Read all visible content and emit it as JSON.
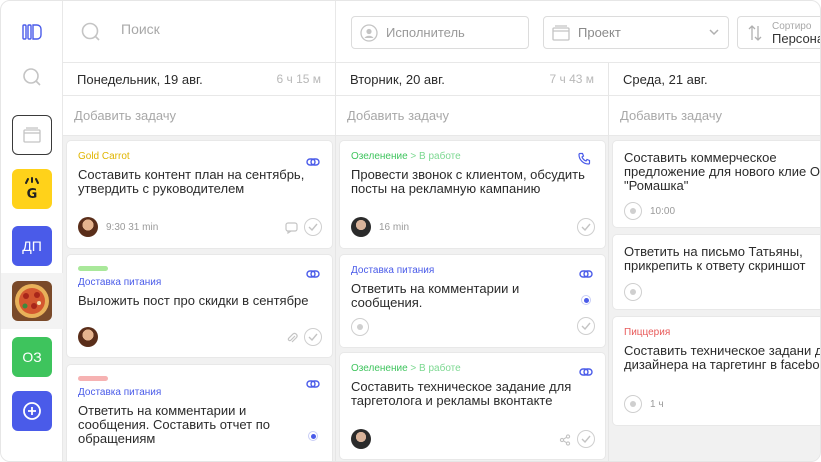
{
  "search": {
    "placeholder": "Поиск"
  },
  "filters": {
    "executor": "Исполнитель",
    "project": "Проект",
    "sort_small": "Сортиро",
    "sort_value": "Персона"
  },
  "sidebar": {
    "items": [
      {
        "label": "ДП"
      },
      {
        "label": "ОЗ"
      }
    ]
  },
  "columns": [
    {
      "day": "Понедельник, 19 авг.",
      "duration": "6 ч 15 м",
      "add_task": "Добавить задачу",
      "cards": [
        {
          "project": "Gold Carrot",
          "project_color": "#e0b500",
          "title": "Составить контент план на сентябрь, утвердить с руководителем",
          "time": "9:30 31 min"
        },
        {
          "project": "Доставка питания",
          "project_color": "#4a5be9",
          "bar_color": "#a9e89a",
          "title": "Выложить пост про скидки в сентябре"
        },
        {
          "project": "Доставка питания",
          "project_color": "#4a5be9",
          "bar_color": "#f6b2b2",
          "title": "Ответить на комментарии и сообщения. Составить отчет по обращениям"
        }
      ]
    },
    {
      "day": "Вторник, 20 авг.",
      "duration": "7 ч 43 м",
      "add_task": "Добавить задачу",
      "cards": [
        {
          "project": "Озеленение",
          "status": "> В работе",
          "project_color": "#3ec45d",
          "title": "Провести звонок с клиентом, обсудить посты на рекламную кампанию",
          "time": "16 min"
        },
        {
          "project": "Доставка питания",
          "project_color": "#4a5be9",
          "title": "Ответить на комментарии и сообщения."
        },
        {
          "project": "Озеленение",
          "status": "> В работе",
          "project_color": "#3ec45d",
          "title": "Составить техническое задание для таргетолога и рекламы вконтакте"
        }
      ]
    },
    {
      "day": "Среда, 21 авг.",
      "duration": "",
      "add_task": "Добавить задачу",
      "cards": [
        {
          "title": "Составить коммерческое предложение для нового клие ООО \"Ромашка\"",
          "time": "10:00"
        },
        {
          "title": "Ответить на письмо Татьяны, прикрепить к ответу скриншот"
        },
        {
          "project": "Пиццерия",
          "project_color": "#e85a5a",
          "title": "Составить техническое задани для дизайнера на таргетинг в facebook",
          "time": "1 ч"
        }
      ]
    }
  ],
  "colors": {
    "accent": "#4a5be9",
    "green": "#3ec45d",
    "yellow": "#ffd21a"
  },
  "icons": [
    "logo-icon",
    "search-icon",
    "calendar-icon",
    "user-icon",
    "folder-icon",
    "sort-icon",
    "chevron-down-icon",
    "check-icon",
    "link-icon",
    "phone-icon",
    "comment-icon",
    "attachment-icon",
    "share-icon",
    "plus-icon"
  ]
}
